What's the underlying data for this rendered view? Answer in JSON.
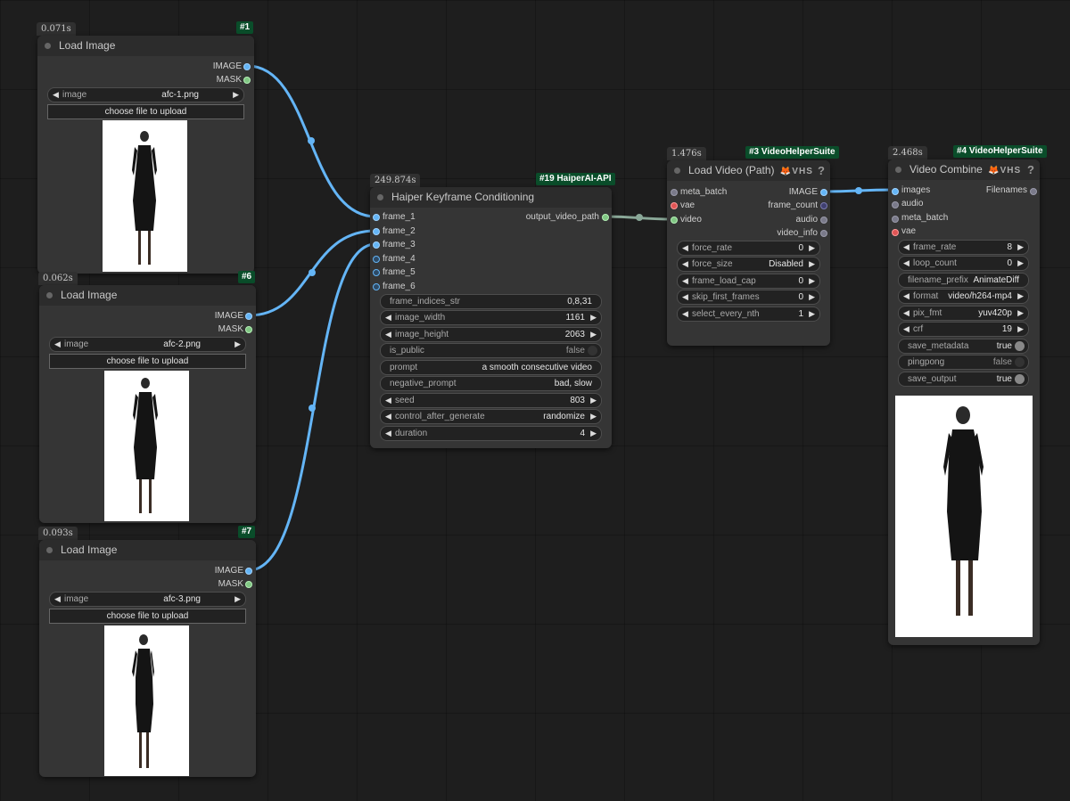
{
  "colors": {
    "canvas_bg": "#1e1e1e",
    "node_bg": "#353535",
    "title_bg": "#2c2c2c",
    "badge_bg": "#0a4d2a",
    "image_link": "#64b5f6",
    "video_link": "#8aa898"
  },
  "nodes": {
    "load1": {
      "timing": "0.071s",
      "badge": "#1",
      "title": "Load Image",
      "outputs": [
        "IMAGE",
        "MASK"
      ],
      "image_widget": {
        "name": "image",
        "value": "afc-1.png"
      },
      "upload_button": "choose file to upload"
    },
    "load6": {
      "timing": "0.062s",
      "badge": "#6",
      "title": "Load Image",
      "outputs": [
        "IMAGE",
        "MASK"
      ],
      "image_widget": {
        "name": "image",
        "value": "afc-2.png"
      },
      "upload_button": "choose file to upload"
    },
    "load7": {
      "timing": "0.093s",
      "badge": "#7",
      "title": "Load Image",
      "outputs": [
        "IMAGE",
        "MASK"
      ],
      "image_widget": {
        "name": "image",
        "value": "afc-3.png"
      },
      "upload_button": "choose file to upload"
    },
    "haiper": {
      "timing": "249.874s",
      "badge": "#19 HaiperAI-API",
      "title": "Haiper Keyframe Conditioning",
      "inputs": [
        "frame_1",
        "frame_2",
        "frame_3",
        "frame_4",
        "frame_5",
        "frame_6"
      ],
      "output": "output_video_path",
      "widgets": [
        {
          "name": "frame_indices_str",
          "value": "0,8,31"
        },
        {
          "name": "image_width",
          "value": "1161"
        },
        {
          "name": "image_height",
          "value": "2063"
        },
        {
          "name": "is_public",
          "value": "false"
        },
        {
          "name": "prompt",
          "value": "a smooth consecutive video"
        },
        {
          "name": "negative_prompt",
          "value": "bad, slow"
        },
        {
          "name": "seed",
          "value": "803"
        },
        {
          "name": "control_after_generate",
          "value": "randomize"
        },
        {
          "name": "duration",
          "value": "4"
        }
      ]
    },
    "loadvideo": {
      "timing": "1.476s",
      "badge": "#3 VideoHelperSuite",
      "title": "Load Video (Path)",
      "tag": "🦊VHS",
      "help": "?",
      "inputs": [
        "meta_batch",
        "vae",
        "video"
      ],
      "outputs": [
        "IMAGE",
        "frame_count",
        "audio",
        "video_info"
      ],
      "widgets": [
        {
          "name": "force_rate",
          "value": "0"
        },
        {
          "name": "force_size",
          "value": "Disabled"
        },
        {
          "name": "frame_load_cap",
          "value": "0"
        },
        {
          "name": "skip_first_frames",
          "value": "0"
        },
        {
          "name": "select_every_nth",
          "value": "1"
        }
      ]
    },
    "combine": {
      "timing": "2.468s",
      "badge": "#4 VideoHelperSuite",
      "title": "Video Combine",
      "tag": "🦊VHS",
      "help": "?",
      "inputs": [
        "images",
        "audio",
        "meta_batch",
        "vae"
      ],
      "output": "Filenames",
      "widgets": [
        {
          "name": "frame_rate",
          "value": "8"
        },
        {
          "name": "loop_count",
          "value": "0"
        },
        {
          "name": "filename_prefix",
          "value": "AnimateDiff"
        },
        {
          "name": "format",
          "value": "video/h264-mp4"
        },
        {
          "name": "pix_fmt",
          "value": "yuv420p"
        },
        {
          "name": "crf",
          "value": "19"
        },
        {
          "name": "save_metadata",
          "value": "true"
        },
        {
          "name": "pingpong",
          "value": "false"
        },
        {
          "name": "save_output",
          "value": "true"
        }
      ]
    }
  }
}
